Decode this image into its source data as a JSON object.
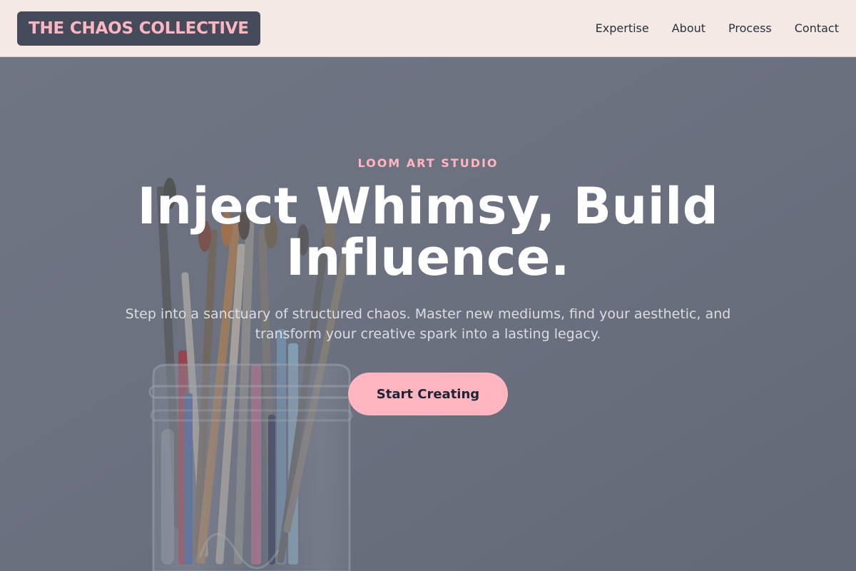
{
  "header": {
    "logo_text": "THE CHAOS COLLECTIVE",
    "nav": [
      {
        "label": "Expertise"
      },
      {
        "label": "About"
      },
      {
        "label": "Process"
      },
      {
        "label": "Contact"
      }
    ]
  },
  "hero": {
    "eyebrow": "LOOM ART STUDIO",
    "headline": "Inject Whimsy, Build Influence.",
    "subtext": "Step into a sanctuary of structured chaos. Master new mediums, find your aesthetic, and transform your creative spark into a lasting legacy.",
    "cta_label": "Start Creating",
    "background_image": "paintbrushes-in-glass-jar-photo"
  },
  "colors": {
    "accent_pink": "#ffb6c1",
    "header_bg": "#f4e9e5",
    "logo_bg": "#454b5a",
    "hero_bg": "#6f7482",
    "text_dark": "#1f2433"
  }
}
